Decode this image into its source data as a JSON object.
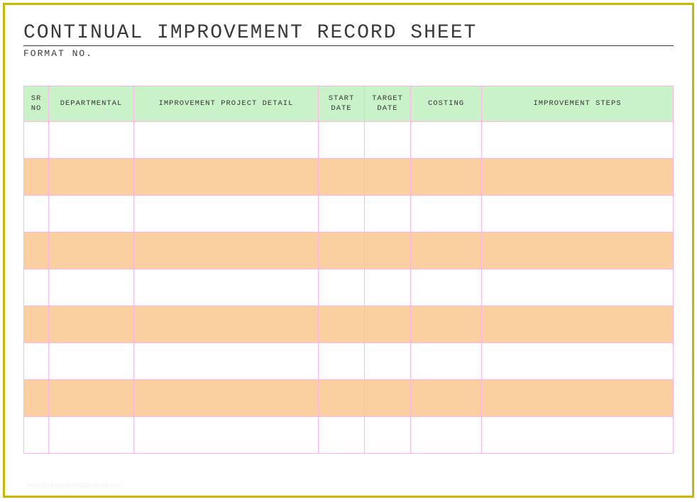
{
  "title": "CONTINUAL IMPROVEMENT RECORD SHEET",
  "subtitle": "FORMAT NO.",
  "columns": {
    "sr": "SR NO",
    "dept": "DEPARTMENTAL",
    "proj": "IMPROVEMENT PROJECT DETAIL",
    "start": "START DATE",
    "target": "TARGET DATE",
    "cost": "COSTING",
    "steps": "IMPROVEMENT STEPS"
  },
  "rows": [
    {
      "sr": "",
      "dept": "",
      "proj": "",
      "start": "",
      "target": "",
      "cost": "",
      "steps": ""
    },
    {
      "sr": "",
      "dept": "",
      "proj": "",
      "start": "",
      "target": "",
      "cost": "",
      "steps": ""
    },
    {
      "sr": "",
      "dept": "",
      "proj": "",
      "start": "",
      "target": "",
      "cost": "",
      "steps": ""
    },
    {
      "sr": "",
      "dept": "",
      "proj": "",
      "start": "",
      "target": "",
      "cost": "",
      "steps": ""
    },
    {
      "sr": "",
      "dept": "",
      "proj": "",
      "start": "",
      "target": "",
      "cost": "",
      "steps": ""
    },
    {
      "sr": "",
      "dept": "",
      "proj": "",
      "start": "",
      "target": "",
      "cost": "",
      "steps": ""
    },
    {
      "sr": "",
      "dept": "",
      "proj": "",
      "start": "",
      "target": "",
      "cost": "",
      "steps": ""
    },
    {
      "sr": "",
      "dept": "",
      "proj": "",
      "start": "",
      "target": "",
      "cost": "",
      "steps": ""
    },
    {
      "sr": "",
      "dept": "",
      "proj": "",
      "start": "",
      "target": "",
      "cost": "",
      "steps": ""
    }
  ],
  "watermark": "www.heritagechristiancollege.com"
}
